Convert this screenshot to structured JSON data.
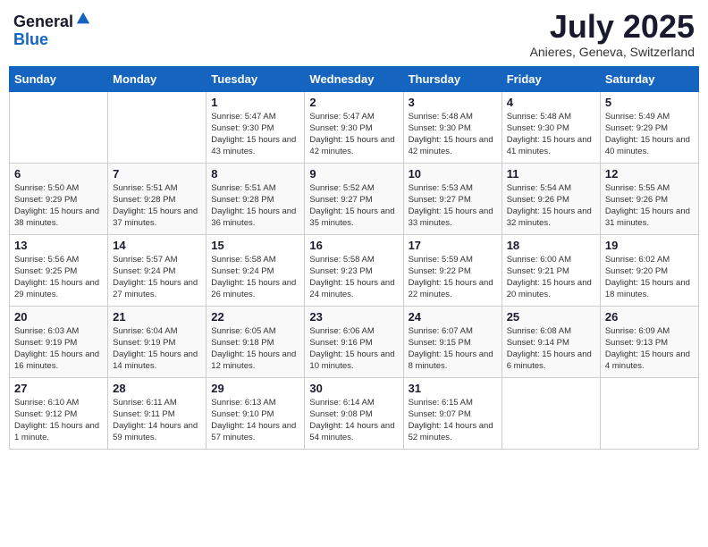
{
  "header": {
    "logo_line1": "General",
    "logo_line2": "Blue",
    "month": "July 2025",
    "location": "Anieres, Geneva, Switzerland"
  },
  "days_of_week": [
    "Sunday",
    "Monday",
    "Tuesday",
    "Wednesday",
    "Thursday",
    "Friday",
    "Saturday"
  ],
  "weeks": [
    [
      {
        "day": "",
        "sunrise": "",
        "sunset": "",
        "daylight": ""
      },
      {
        "day": "",
        "sunrise": "",
        "sunset": "",
        "daylight": ""
      },
      {
        "day": "1",
        "sunrise": "Sunrise: 5:47 AM",
        "sunset": "Sunset: 9:30 PM",
        "daylight": "Daylight: 15 hours and 43 minutes."
      },
      {
        "day": "2",
        "sunrise": "Sunrise: 5:47 AM",
        "sunset": "Sunset: 9:30 PM",
        "daylight": "Daylight: 15 hours and 42 minutes."
      },
      {
        "day": "3",
        "sunrise": "Sunrise: 5:48 AM",
        "sunset": "Sunset: 9:30 PM",
        "daylight": "Daylight: 15 hours and 42 minutes."
      },
      {
        "day": "4",
        "sunrise": "Sunrise: 5:48 AM",
        "sunset": "Sunset: 9:30 PM",
        "daylight": "Daylight: 15 hours and 41 minutes."
      },
      {
        "day": "5",
        "sunrise": "Sunrise: 5:49 AM",
        "sunset": "Sunset: 9:29 PM",
        "daylight": "Daylight: 15 hours and 40 minutes."
      }
    ],
    [
      {
        "day": "6",
        "sunrise": "Sunrise: 5:50 AM",
        "sunset": "Sunset: 9:29 PM",
        "daylight": "Daylight: 15 hours and 38 minutes."
      },
      {
        "day": "7",
        "sunrise": "Sunrise: 5:51 AM",
        "sunset": "Sunset: 9:28 PM",
        "daylight": "Daylight: 15 hours and 37 minutes."
      },
      {
        "day": "8",
        "sunrise": "Sunrise: 5:51 AM",
        "sunset": "Sunset: 9:28 PM",
        "daylight": "Daylight: 15 hours and 36 minutes."
      },
      {
        "day": "9",
        "sunrise": "Sunrise: 5:52 AM",
        "sunset": "Sunset: 9:27 PM",
        "daylight": "Daylight: 15 hours and 35 minutes."
      },
      {
        "day": "10",
        "sunrise": "Sunrise: 5:53 AM",
        "sunset": "Sunset: 9:27 PM",
        "daylight": "Daylight: 15 hours and 33 minutes."
      },
      {
        "day": "11",
        "sunrise": "Sunrise: 5:54 AM",
        "sunset": "Sunset: 9:26 PM",
        "daylight": "Daylight: 15 hours and 32 minutes."
      },
      {
        "day": "12",
        "sunrise": "Sunrise: 5:55 AM",
        "sunset": "Sunset: 9:26 PM",
        "daylight": "Daylight: 15 hours and 31 minutes."
      }
    ],
    [
      {
        "day": "13",
        "sunrise": "Sunrise: 5:56 AM",
        "sunset": "Sunset: 9:25 PM",
        "daylight": "Daylight: 15 hours and 29 minutes."
      },
      {
        "day": "14",
        "sunrise": "Sunrise: 5:57 AM",
        "sunset": "Sunset: 9:24 PM",
        "daylight": "Daylight: 15 hours and 27 minutes."
      },
      {
        "day": "15",
        "sunrise": "Sunrise: 5:58 AM",
        "sunset": "Sunset: 9:24 PM",
        "daylight": "Daylight: 15 hours and 26 minutes."
      },
      {
        "day": "16",
        "sunrise": "Sunrise: 5:58 AM",
        "sunset": "Sunset: 9:23 PM",
        "daylight": "Daylight: 15 hours and 24 minutes."
      },
      {
        "day": "17",
        "sunrise": "Sunrise: 5:59 AM",
        "sunset": "Sunset: 9:22 PM",
        "daylight": "Daylight: 15 hours and 22 minutes."
      },
      {
        "day": "18",
        "sunrise": "Sunrise: 6:00 AM",
        "sunset": "Sunset: 9:21 PM",
        "daylight": "Daylight: 15 hours and 20 minutes."
      },
      {
        "day": "19",
        "sunrise": "Sunrise: 6:02 AM",
        "sunset": "Sunset: 9:20 PM",
        "daylight": "Daylight: 15 hours and 18 minutes."
      }
    ],
    [
      {
        "day": "20",
        "sunrise": "Sunrise: 6:03 AM",
        "sunset": "Sunset: 9:19 PM",
        "daylight": "Daylight: 15 hours and 16 minutes."
      },
      {
        "day": "21",
        "sunrise": "Sunrise: 6:04 AM",
        "sunset": "Sunset: 9:19 PM",
        "daylight": "Daylight: 15 hours and 14 minutes."
      },
      {
        "day": "22",
        "sunrise": "Sunrise: 6:05 AM",
        "sunset": "Sunset: 9:18 PM",
        "daylight": "Daylight: 15 hours and 12 minutes."
      },
      {
        "day": "23",
        "sunrise": "Sunrise: 6:06 AM",
        "sunset": "Sunset: 9:16 PM",
        "daylight": "Daylight: 15 hours and 10 minutes."
      },
      {
        "day": "24",
        "sunrise": "Sunrise: 6:07 AM",
        "sunset": "Sunset: 9:15 PM",
        "daylight": "Daylight: 15 hours and 8 minutes."
      },
      {
        "day": "25",
        "sunrise": "Sunrise: 6:08 AM",
        "sunset": "Sunset: 9:14 PM",
        "daylight": "Daylight: 15 hours and 6 minutes."
      },
      {
        "day": "26",
        "sunrise": "Sunrise: 6:09 AM",
        "sunset": "Sunset: 9:13 PM",
        "daylight": "Daylight: 15 hours and 4 minutes."
      }
    ],
    [
      {
        "day": "27",
        "sunrise": "Sunrise: 6:10 AM",
        "sunset": "Sunset: 9:12 PM",
        "daylight": "Daylight: 15 hours and 1 minute."
      },
      {
        "day": "28",
        "sunrise": "Sunrise: 6:11 AM",
        "sunset": "Sunset: 9:11 PM",
        "daylight": "Daylight: 14 hours and 59 minutes."
      },
      {
        "day": "29",
        "sunrise": "Sunrise: 6:13 AM",
        "sunset": "Sunset: 9:10 PM",
        "daylight": "Daylight: 14 hours and 57 minutes."
      },
      {
        "day": "30",
        "sunrise": "Sunrise: 6:14 AM",
        "sunset": "Sunset: 9:08 PM",
        "daylight": "Daylight: 14 hours and 54 minutes."
      },
      {
        "day": "31",
        "sunrise": "Sunrise: 6:15 AM",
        "sunset": "Sunset: 9:07 PM",
        "daylight": "Daylight: 14 hours and 52 minutes."
      },
      {
        "day": "",
        "sunrise": "",
        "sunset": "",
        "daylight": ""
      },
      {
        "day": "",
        "sunrise": "",
        "sunset": "",
        "daylight": ""
      }
    ]
  ]
}
